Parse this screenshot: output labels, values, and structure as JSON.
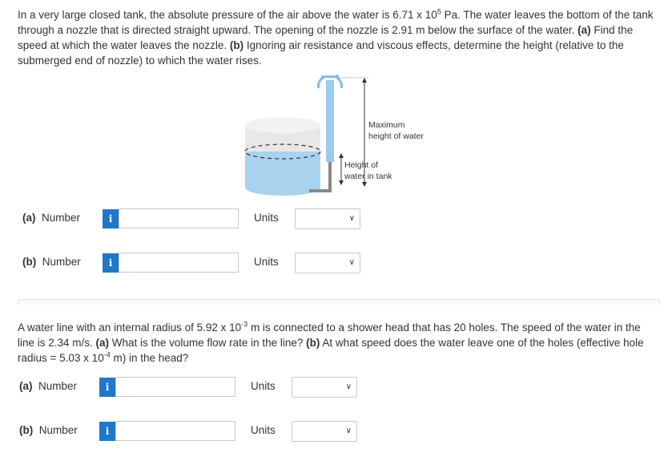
{
  "problem1": {
    "text_part1": "In a very large closed tank, the absolute pressure of the air above the water is 6.71 x 10",
    "exp1": "5",
    "text_part2": " Pa. The water leaves the bottom of the tank through a nozzle that is directed straight upward. The opening of the nozzle is 2.91 m below the surface of the water. ",
    "label_a": "(a)",
    "text_a": " Find the speed at which the water leaves the nozzle. ",
    "label_b": "(b)",
    "text_b": " Ignoring air resistance and viscous effects, determine the height (relative to the submerged end of nozzle) to which the water rises."
  },
  "figure": {
    "max_height_label_line1": "Maximum",
    "max_height_label_line2": "height of water",
    "tank_height_label_line1": "Height of",
    "tank_height_label_line2": "water in tank"
  },
  "answers1": [
    {
      "part": "(a)",
      "number_label": "Number",
      "info_icon": "i",
      "units_label": "Units"
    },
    {
      "part": "(b)",
      "number_label": "Number",
      "info_icon": "i",
      "units_label": "Units"
    }
  ],
  "problem2": {
    "text_part1": "A water line with an internal radius of 5.92 x 10",
    "exp1": "-3",
    "text_part2": " m is connected to a shower head that has 20 holes. The speed of the water in the line is 2.34 m/s. ",
    "label_a": "(a)",
    "text_a": " What is the volume flow rate in the line? ",
    "label_b": "(b)",
    "text_b1": " At what speed does the water leave one of the holes (effective hole radius = 5.03 x 10",
    "exp2": "-4",
    "text_b2": " m) in the head?"
  },
  "answers2": [
    {
      "part": "(a)",
      "number_label": "Number",
      "info_icon": "i",
      "units_label": "Units"
    },
    {
      "part": "(b)",
      "number_label": "Number",
      "info_icon": "i",
      "units_label": "Units"
    }
  ],
  "colors": {
    "info_button": "#1f78c8",
    "water": "#a9d2ee",
    "tank": "#e6e6e6"
  }
}
